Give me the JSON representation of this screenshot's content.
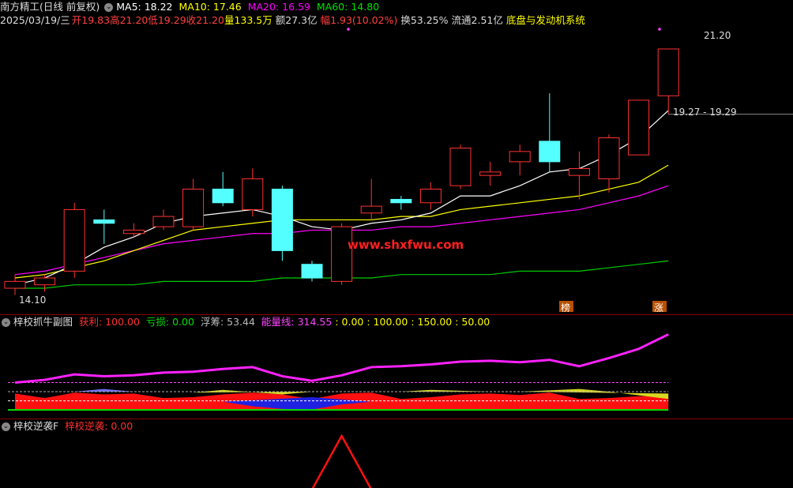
{
  "header": {
    "stock": "南方精工(日线 前复权)",
    "ma5": "MA5: 18.22",
    "ma10": "MA10: 17.46",
    "ma20": "MA20: 16.59",
    "ma60": "MA60: 14.80",
    "date": "2025/03/19/三",
    "open": "开19.83",
    "high": "高21.20",
    "low": "低19.29",
    "close": "收21.20",
    "volume": "量133.5万",
    "amount": "额27.3亿",
    "change": "幅1.93(10.02%)",
    "turnover": "换53.25%",
    "float_cap": "流通2.51亿",
    "sector": "底盘与发动机系统"
  },
  "annotations": {
    "high_label": "21.20",
    "low_label": "14.10",
    "range_label": "19.27 - 19.29",
    "watermark": "www.shxfwu.com",
    "tag_bang": "榜",
    "tag_zhang": "涨"
  },
  "panel2": {
    "title": "梓校抓牛副图",
    "profit": "获利: 100.00",
    "loss": "亏损: 0.00",
    "float": "浮筹: 53.44",
    "energy": "能量线: 314.55",
    "v1": ": 0.00",
    "v2": ": 100.00",
    "v3": ": 150.00",
    "v4": ": 50.00"
  },
  "panel3": {
    "title": "梓校逆袭F",
    "value": "梓校逆袭: 0.00"
  },
  "colors": {
    "up": "#ff3232",
    "down": "#54ffff",
    "ma5": "#ffffff",
    "ma10": "#ffff00",
    "ma20": "#ff00ff",
    "ma60": "#00cc00"
  },
  "chart_data": [
    {
      "type": "candlestick",
      "title": "南方精工(日线 前复权)",
      "candles": [
        {
          "o": 14.2,
          "h": 14.6,
          "l": 14.0,
          "c": 14.4
        },
        {
          "o": 14.3,
          "h": 14.6,
          "l": 14.1,
          "c": 14.5
        },
        {
          "o": 14.7,
          "h": 16.7,
          "l": 14.5,
          "c": 16.5
        },
        {
          "o": 16.2,
          "h": 16.5,
          "l": 15.5,
          "c": 16.1
        },
        {
          "o": 15.8,
          "h": 16.1,
          "l": 15.7,
          "c": 15.9
        },
        {
          "o": 16.0,
          "h": 16.5,
          "l": 15.9,
          "c": 16.3
        },
        {
          "o": 16.0,
          "h": 17.4,
          "l": 15.9,
          "c": 17.1
        },
        {
          "o": 17.1,
          "h": 17.6,
          "l": 16.6,
          "c": 16.7
        },
        {
          "o": 16.5,
          "h": 17.7,
          "l": 16.3,
          "c": 17.4
        },
        {
          "o": 17.1,
          "h": 17.2,
          "l": 15.0,
          "c": 15.3
        },
        {
          "o": 14.9,
          "h": 15.0,
          "l": 14.4,
          "c": 14.5
        },
        {
          "o": 14.4,
          "h": 16.1,
          "l": 14.3,
          "c": 16.0
        },
        {
          "o": 16.4,
          "h": 17.4,
          "l": 16.2,
          "c": 16.6
        },
        {
          "o": 16.8,
          "h": 16.9,
          "l": 16.5,
          "c": 16.7
        },
        {
          "o": 16.7,
          "h": 17.3,
          "l": 16.5,
          "c": 17.1
        },
        {
          "o": 17.2,
          "h": 18.4,
          "l": 17.1,
          "c": 18.3
        },
        {
          "o": 17.5,
          "h": 17.9,
          "l": 17.2,
          "c": 17.6
        },
        {
          "o": 17.9,
          "h": 18.4,
          "l": 17.5,
          "c": 18.2
        },
        {
          "o": 18.5,
          "h": 19.9,
          "l": 17.6,
          "c": 17.9
        },
        {
          "o": 17.5,
          "h": 18.2,
          "l": 16.8,
          "c": 17.7
        },
        {
          "o": 17.4,
          "h": 18.7,
          "l": 17.0,
          "c": 18.6
        },
        {
          "o": 18.1,
          "h": 19.7,
          "l": 18.1,
          "c": 19.7
        },
        {
          "o": 19.83,
          "h": 21.2,
          "l": 19.29,
          "c": 21.2
        }
      ],
      "ma5": [
        14.3,
        14.5,
        14.9,
        15.4,
        15.7,
        16.1,
        16.3,
        16.4,
        16.5,
        16.3,
        16.0,
        15.9,
        16.1,
        16.2,
        16.4,
        16.9,
        16.9,
        17.2,
        17.6,
        17.7,
        18.1,
        18.6,
        19.4
      ],
      "ma10": [
        14.5,
        14.6,
        14.8,
        15.0,
        15.3,
        15.6,
        15.9,
        16.0,
        16.1,
        16.2,
        16.2,
        16.2,
        16.2,
        16.3,
        16.3,
        16.5,
        16.6,
        16.7,
        16.8,
        16.9,
        17.1,
        17.3,
        17.8
      ],
      "ma20": [
        14.6,
        14.7,
        14.9,
        15.1,
        15.3,
        15.5,
        15.6,
        15.7,
        15.8,
        15.8,
        15.9,
        15.9,
        15.9,
        16.0,
        16.0,
        16.1,
        16.2,
        16.3,
        16.4,
        16.5,
        16.7,
        16.9,
        17.2
      ],
      "ma60": [
        14.2,
        14.2,
        14.3,
        14.3,
        14.3,
        14.4,
        14.4,
        14.4,
        14.4,
        14.5,
        14.5,
        14.5,
        14.5,
        14.6,
        14.6,
        14.6,
        14.6,
        14.7,
        14.7,
        14.7,
        14.8,
        14.9,
        15.0
      ],
      "ylim": [
        13.9,
        21.8
      ]
    },
    {
      "type": "area",
      "title": "梓校抓牛副图",
      "energy": [
        150,
        165,
        195,
        185,
        190,
        205,
        210,
        225,
        235,
        185,
        160,
        190,
        235,
        240,
        250,
        265,
        270,
        262,
        275,
        240,
        285,
        335,
        415
      ],
      "ylim": [
        -30,
        430
      ],
      "levels": [
        0,
        50,
        100,
        150
      ]
    },
    {
      "type": "line",
      "title": "梓校逆袭F",
      "series": [
        {
          "values": [
            0,
            0,
            0,
            0,
            0,
            0,
            0,
            0,
            0,
            0,
            0,
            100,
            0,
            0,
            0,
            0,
            0,
            0,
            0,
            0,
            0,
            0,
            0
          ]
        }
      ],
      "ylim": [
        0,
        100
      ]
    }
  ]
}
